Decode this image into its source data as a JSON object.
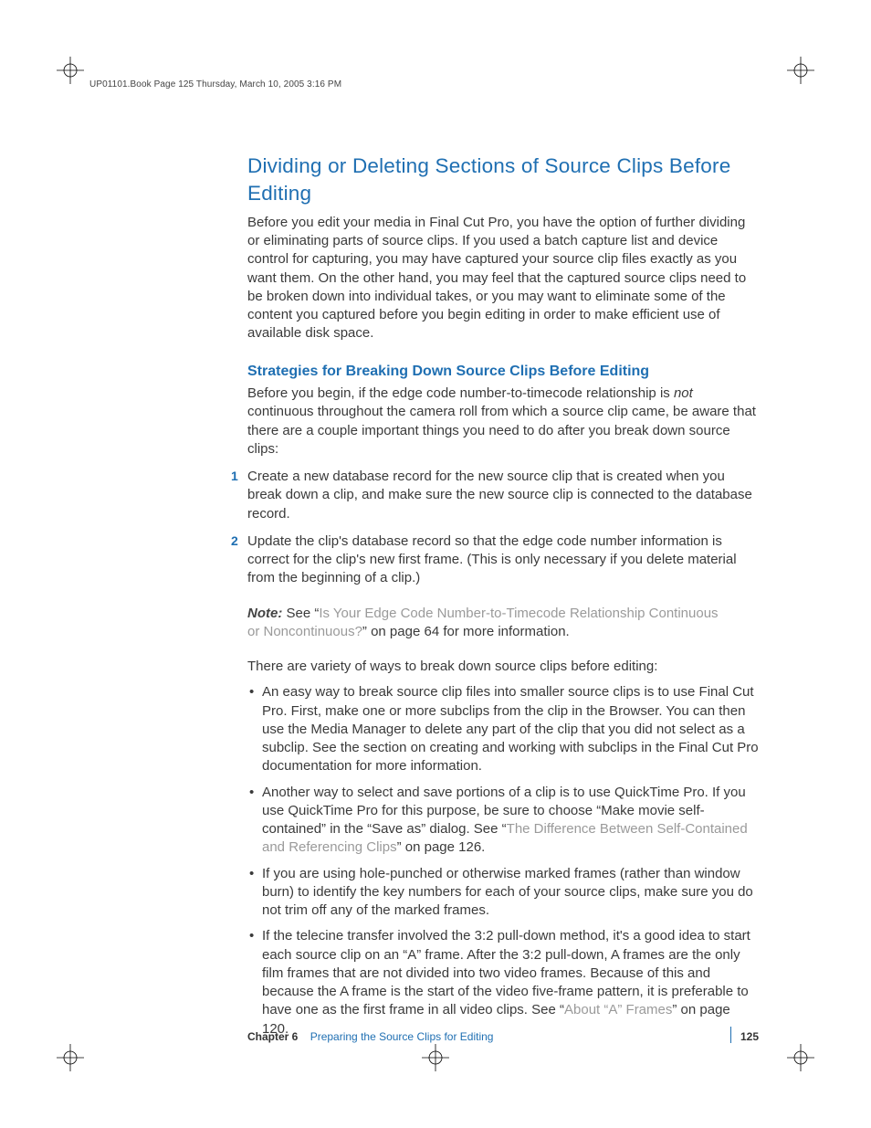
{
  "header_slug": "UP01101.Book  Page 125  Thursday, March 10, 2005  3:16 PM",
  "title": "Dividing or Deleting Sections of Source Clips Before Editing",
  "intro": "Before you edit your media in Final Cut Pro, you have the option of further dividing or eliminating parts of source clips. If you used a batch capture list and device control for capturing, you may have captured your source clip files exactly as you want them. On the other hand, you may feel that the captured source clips need to be broken down into individual takes, or you may want to eliminate some of the content you captured before you begin editing in order to make efficient use of available disk space.",
  "subhead": "Strategies for Breaking Down Source Clips Before Editing",
  "sub_intro_before_em": "Before you begin, if the edge code number-to-timecode relationship is ",
  "sub_intro_em": "not",
  "sub_intro_after_em": " continuous throughout the camera roll from which a source clip came, be aware that there are a couple important things you need to do after you break down source clips:",
  "ol": [
    "Create a new database record for the new source clip that is created when you break down a clip, and make sure the new source clip is connected to the database record.",
    "Update the clip's database record so that the edge code number information is correct for the clip's new first frame. (This is only necessary if you delete material from the beginning of a clip.)"
  ],
  "note": {
    "label": "Note:",
    "pre": "  See “",
    "link": "Is Your Edge Code Number-to-Timecode Relationship Continuous or Noncontinuous?",
    "post": "” on page 64 for more information."
  },
  "variety_line": "There are variety of ways to break down source clips before editing:",
  "bullets": {
    "b1": "An easy way to break source clip files into smaller source clips is to use Final Cut Pro. First, make one or more subclips from the clip in the Browser. You can then use the Media Manager to delete any part of the clip that you did not select as a subclip. See the section on creating and working with subclips in the Final Cut Pro documentation for more information.",
    "b2_pre": "Another way to select and save portions of a clip is to use QuickTime Pro. If you use QuickTime Pro for this purpose, be sure to choose “Make movie self-contained” in the “Save as” dialog. See “",
    "b2_link": "The Difference Between Self-Contained and Referencing Clips",
    "b2_post": "” on page 126.",
    "b3": "If you are using hole-punched or otherwise marked frames (rather than window burn) to identify the key numbers for each of your source clips, make sure you do not trim off any of the marked frames.",
    "b4_pre": "If the telecine transfer involved the 3:2 pull-down method, it's a good idea to start each source clip on an “A” frame. After the 3:2 pull-down, A frames are the only film frames that are not divided into two video frames. Because of this and because the A frame is the start of the video five-frame pattern, it is preferable to have one as the first frame in all video clips. See “",
    "b4_link": "About “A” Frames",
    "b4_post": "” on page 120."
  },
  "footer": {
    "chapter_label": "Chapter 6",
    "chapter_title": "Preparing the Source Clips for Editing",
    "page": "125"
  }
}
